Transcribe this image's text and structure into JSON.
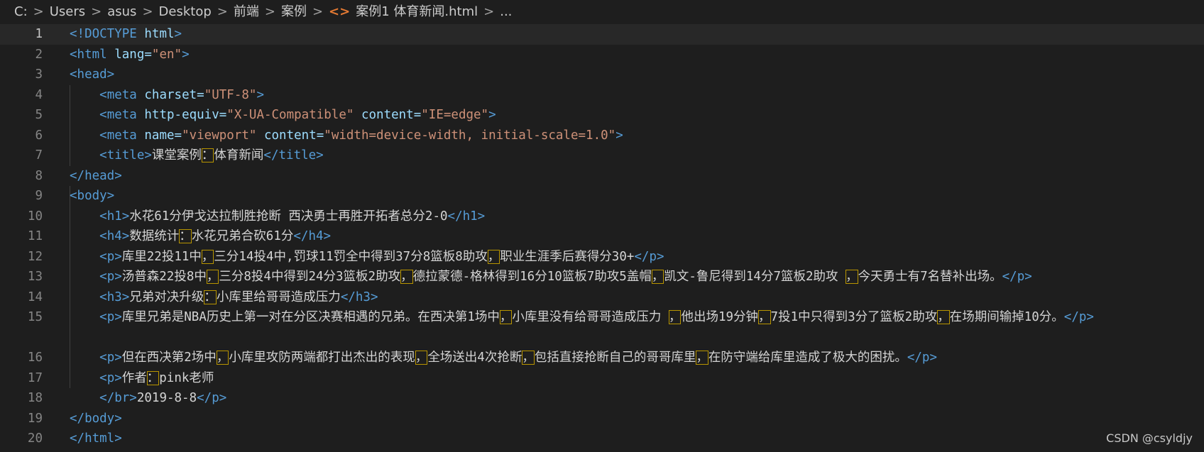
{
  "breadcrumb": {
    "items": [
      "C:",
      "Users",
      "asus",
      "Desktop",
      "前端",
      "案例",
      "案例1 体育新闻.html",
      "..."
    ],
    "icon": "html-file-icon"
  },
  "editor": {
    "line_numbers": [
      "1",
      "2",
      "3",
      "4",
      "5",
      "6",
      "7",
      "8",
      "9",
      "10",
      "11",
      "12",
      "13",
      "14",
      "15",
      "16",
      "17",
      "18",
      "19",
      "20"
    ],
    "tokens": {
      "l1_doctype": "<!DOCTYPE",
      "l1_html": "html",
      "l1_close": ">",
      "l2_open": "<html",
      "l2_attr": "lang=",
      "l2_val": "\"en\"",
      "l2_close": ">",
      "l3": "<head>",
      "l4_open": "<meta",
      "l4_attr": "charset=",
      "l4_val": "\"UTF-8\"",
      "l4_close": ">",
      "l5_open": "<meta",
      "l5_attr1": "http-equiv=",
      "l5_val1": "\"X-UA-Compatible\"",
      "l5_attr2": "content=",
      "l5_val2": "\"IE=edge\"",
      "l5_close": ">",
      "l6_open": "<meta",
      "l6_attr1": "name=",
      "l6_val1": "\"viewport\"",
      "l6_attr2": "content=",
      "l6_val2": "\"width=device-width, initial-scale=1.0\"",
      "l6_close": ">",
      "l7_open": "<title>",
      "l7_text1": "课堂案例",
      "l7_colon": "：",
      "l7_text2": "体育新闻",
      "l7_close": "</title>",
      "l8": "</head>",
      "l9": "<body>",
      "l10_open": "<h1>",
      "l10_text": "水花61分伊戈达拉制胜抢断 西决勇士再胜开拓者总分2-0",
      "l10_close": "</h1>",
      "l11_open": "<h4>",
      "l11_text1": "数据统计",
      "l11_colon": "：",
      "l11_text2": "水花兄弟合砍61分",
      "l11_close": "</h4>",
      "l12_open": "<p>",
      "l12_t1": "库里22投11中",
      "l12_c1": "，",
      "l12_t2": "三分14投4中,罚球11罚全中得到37分8篮板8助攻",
      "l12_c2": "，",
      "l12_t3": "职业生涯季后赛得分30+",
      "l12_close": "</p>",
      "l13_open": "<p>",
      "l13_t1": "汤普森22投8中",
      "l13_c1": "，",
      "l13_t2": "三分8投4中得到24分3篮板2助攻",
      "l13_c2": "，",
      "l13_t3": "德拉蒙德-格林得到16分10篮板7助攻5盖帽",
      "l13_c3": "，",
      "l13_t4": "凯文-鲁尼得到14分7篮板2助攻 ",
      "l13_c4": "，",
      "l13_t5": "今天勇士有7名替补出场。",
      "l13_close": "</p>",
      "l14_open": "<h3>",
      "l14_t1": "兄弟对决升级",
      "l14_c1": "：",
      "l14_t2": "小库里给哥哥造成压力",
      "l14_close": "</h3>",
      "l15_open": "<p>",
      "l15_t1": "库里兄弟是NBA历史上第一对在分区决赛相遇的兄弟。在西决第1场中",
      "l15_c1": "，",
      "l15_t2": "小库里没有给哥哥造成压力 ",
      "l15_c2": "，",
      "l15_t3": "他出场19分钟",
      "l15_c3": "，",
      "l15_t4": "7投1中只得到3分了篮板2助攻",
      "l15_c4": "，",
      "l15_t5": "在场期间输掉10分。",
      "l15_close": "</p>",
      "l16_open": "<p>",
      "l16_t1": "但在西决第2场中",
      "l16_c1": "，",
      "l16_t2": "小库里攻防两端都打出杰出的表现",
      "l16_c2": "，",
      "l16_t3": "全场送出4次抢断",
      "l16_c3": "，",
      "l16_t4": "包括直接抢断自己的哥哥库里",
      "l16_c4": "，",
      "l16_t5": "在防守端给库里造成了极大的困扰。",
      "l16_close": "</p>",
      "l17_open": "<p>",
      "l17_t1": "作者",
      "l17_c1": "：",
      "l17_t2": "pink老师",
      "l18_open": "</br>",
      "l18_text": "2019-8-8",
      "l18_close": "</p>",
      "l19": "</body>",
      "l20": "</html>"
    }
  },
  "watermark": "CSDN @csyldjy",
  "colors": {
    "background": "#1e1e1e",
    "tag": "#569cd6",
    "attribute": "#9cdcfe",
    "string": "#ce9178",
    "text": "#d4d4d4",
    "line_number": "#858585",
    "highlight_border": "#b89500"
  }
}
